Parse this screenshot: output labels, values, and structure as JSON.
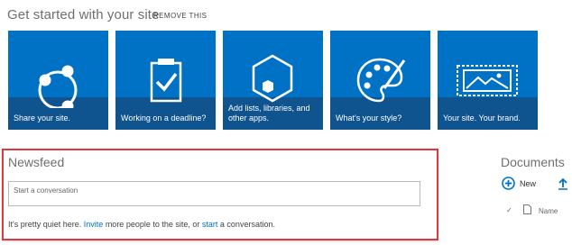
{
  "get_started": {
    "title": "Get started with your site",
    "remove_label": "REMOVE THIS",
    "tiles": [
      {
        "label": "Share your site.",
        "icon": "share-icon"
      },
      {
        "label": "Working on a deadline?",
        "icon": "clipboard-check-icon"
      },
      {
        "label": "Add lists, libraries, and other apps.",
        "icon": "hexagon-apps-icon"
      },
      {
        "label": "What's your style?",
        "icon": "palette-icon"
      },
      {
        "label": "Your site. Your brand.",
        "icon": "image-brand-icon"
      }
    ]
  },
  "newsfeed": {
    "title": "Newsfeed",
    "input_placeholder": "Start a conversation",
    "quiet_prefix": "It's pretty quiet here.",
    "invite_link": "Invite",
    "quiet_middle": "more people to the site, or",
    "start_link": "start",
    "quiet_suffix": "a conversation."
  },
  "documents": {
    "title": "Documents",
    "new_label": "New",
    "check_glyph": "✓",
    "name_column": "Name"
  },
  "colors": {
    "tile_blue": "#0072c6",
    "tile_band": "#10548f",
    "highlight_red": "#e0383e",
    "link_blue": "#0072c6"
  }
}
